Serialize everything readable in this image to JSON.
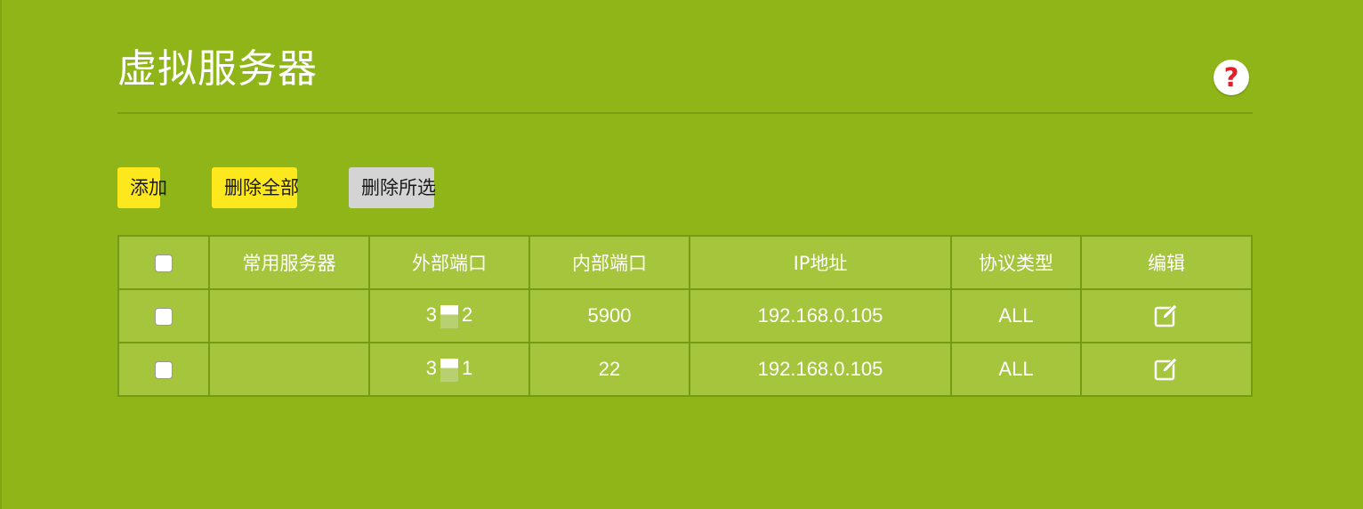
{
  "page": {
    "title": "虚拟服务器",
    "help_icon_glyph": "?"
  },
  "toolbar": {
    "add_label": "添加",
    "delete_all_label": "删除全部",
    "delete_selected_label": "删除所选"
  },
  "table": {
    "headers": {
      "common_server": "常用服务器",
      "external_port": "外部端口",
      "internal_port": "内部端口",
      "ip_address": "IP地址",
      "protocol": "协议类型",
      "edit": "编辑"
    },
    "rows": [
      {
        "common_server": "",
        "external_port_prefix": "3",
        "external_port_suffix": "2",
        "internal_port": "5900",
        "ip_address": "192.168.0.105",
        "protocol": "ALL",
        "selected": false
      },
      {
        "common_server": "",
        "external_port_prefix": "3",
        "external_port_suffix": "1",
        "internal_port": "22",
        "ip_address": "192.168.0.105",
        "protocol": "ALL",
        "selected": false
      }
    ]
  },
  "colors": {
    "background": "#8fb518",
    "table_fill": "#a4c53c",
    "primary_button": "#fce81d",
    "secondary_button": "#d4d4d4",
    "help_icon": "#e3202a"
  }
}
